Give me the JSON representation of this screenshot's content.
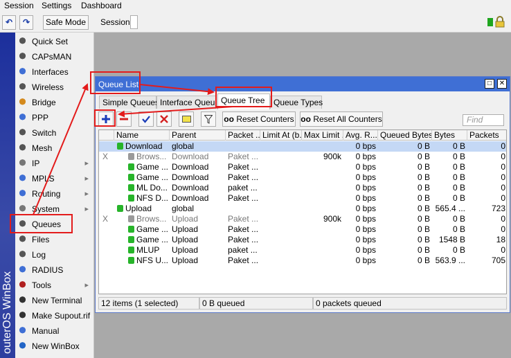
{
  "menubar": [
    "Session",
    "Settings",
    "Dashboard"
  ],
  "toolbar": {
    "undo": "↶",
    "redo": "↷",
    "safe_mode": "Safe Mode",
    "session_label": "Session:"
  },
  "brand": "outerOS WinBox",
  "sidebar": [
    {
      "label": "Quick Set",
      "icon": "quick-set-icon",
      "arrow": ""
    },
    {
      "label": "CAPsMAN",
      "icon": "capsman-icon",
      "arrow": ""
    },
    {
      "label": "Interfaces",
      "icon": "interfaces-icon",
      "arrow": ""
    },
    {
      "label": "Wireless",
      "icon": "wireless-icon",
      "arrow": ""
    },
    {
      "label": "Bridge",
      "icon": "bridge-icon",
      "arrow": ""
    },
    {
      "label": "PPP",
      "icon": "ppp-icon",
      "arrow": ""
    },
    {
      "label": "Switch",
      "icon": "switch-icon",
      "arrow": ""
    },
    {
      "label": "Mesh",
      "icon": "mesh-icon",
      "arrow": ""
    },
    {
      "label": "IP",
      "icon": "ip-icon",
      "arrow": "▸"
    },
    {
      "label": "MPLS",
      "icon": "mpls-icon",
      "arrow": "▸"
    },
    {
      "label": "Routing",
      "icon": "routing-icon",
      "arrow": "▸"
    },
    {
      "label": "System",
      "icon": "system-gear-icon",
      "arrow": "▸"
    },
    {
      "label": "Queues",
      "icon": "queues-icon",
      "arrow": ""
    },
    {
      "label": "Files",
      "icon": "files-icon",
      "arrow": ""
    },
    {
      "label": "Log",
      "icon": "log-icon",
      "arrow": ""
    },
    {
      "label": "RADIUS",
      "icon": "radius-icon",
      "arrow": ""
    },
    {
      "label": "Tools",
      "icon": "tools-icon",
      "arrow": "▸"
    },
    {
      "label": "New Terminal",
      "icon": "terminal-icon",
      "arrow": ""
    },
    {
      "label": "Make Supout.rif",
      "icon": "supout-icon",
      "arrow": ""
    },
    {
      "label": "Manual",
      "icon": "manual-icon",
      "arrow": ""
    },
    {
      "label": "New WinBox",
      "icon": "winbox-icon",
      "arrow": ""
    }
  ],
  "window": {
    "title": "Queue List",
    "restore_glyph": "□",
    "close_glyph": "✕",
    "tabs": [
      "Simple Queues",
      "Interface Queues",
      "Queue Tree",
      "Queue Types"
    ],
    "active_tab": "Queue Tree",
    "buttons": {
      "reset_counters": "Reset Counters",
      "reset_all_counters": "Reset All Counters",
      "oo": "oo"
    },
    "find_placeholder": "Find"
  },
  "table": {
    "columns": [
      "",
      "Name",
      "Parent",
      "Packet ...",
      "Limit At (b...",
      "Max Limit ...",
      "Avg. R...",
      "Queued Bytes",
      "Bytes",
      "Packets"
    ],
    "rows": [
      {
        "flag": "",
        "name": "Download",
        "parent": "global",
        "packet": "",
        "limit_at": "",
        "max_limit": "",
        "avg": "0 bps",
        "queued": "0 B",
        "bytes": "0 B",
        "packets": "0",
        "indent": 0,
        "disabled": false,
        "selected": true
      },
      {
        "flag": "X",
        "name": "Brows...",
        "parent": "Download",
        "packet": "Paket ...",
        "limit_at": "",
        "max_limit": "900k",
        "avg": "0 bps",
        "queued": "0 B",
        "bytes": "0 B",
        "packets": "0",
        "indent": 1,
        "disabled": true,
        "selected": false
      },
      {
        "flag": "",
        "name": "Game ...",
        "parent": "Download",
        "packet": "Paket ...",
        "limit_at": "",
        "max_limit": "",
        "avg": "0 bps",
        "queued": "0 B",
        "bytes": "0 B",
        "packets": "0",
        "indent": 1,
        "disabled": false,
        "selected": false
      },
      {
        "flag": "",
        "name": "Game ...",
        "parent": "Download",
        "packet": "Paket ...",
        "limit_at": "",
        "max_limit": "",
        "avg": "0 bps",
        "queued": "0 B",
        "bytes": "0 B",
        "packets": "0",
        "indent": 1,
        "disabled": false,
        "selected": false
      },
      {
        "flag": "",
        "name": "ML Do...",
        "parent": "Download",
        "packet": "paket ...",
        "limit_at": "",
        "max_limit": "",
        "avg": "0 bps",
        "queued": "0 B",
        "bytes": "0 B",
        "packets": "0",
        "indent": 1,
        "disabled": false,
        "selected": false
      },
      {
        "flag": "",
        "name": "NFS D...",
        "parent": "Download",
        "packet": "Paket ...",
        "limit_at": "",
        "max_limit": "",
        "avg": "0 bps",
        "queued": "0 B",
        "bytes": "0 B",
        "packets": "0",
        "indent": 1,
        "disabled": false,
        "selected": false
      },
      {
        "flag": "",
        "name": "Upload",
        "parent": "global",
        "packet": "",
        "limit_at": "",
        "max_limit": "",
        "avg": "0 bps",
        "queued": "0 B",
        "bytes": "565.4 ...",
        "packets": "723",
        "indent": 0,
        "disabled": false,
        "selected": false
      },
      {
        "flag": "X",
        "name": "Brows...",
        "parent": "Upload",
        "packet": "Paket ...",
        "limit_at": "",
        "max_limit": "900k",
        "avg": "0 bps",
        "queued": "0 B",
        "bytes": "0 B",
        "packets": "0",
        "indent": 1,
        "disabled": true,
        "selected": false
      },
      {
        "flag": "",
        "name": "Game ...",
        "parent": "Upload",
        "packet": "Paket ...",
        "limit_at": "",
        "max_limit": "",
        "avg": "0 bps",
        "queued": "0 B",
        "bytes": "0 B",
        "packets": "0",
        "indent": 1,
        "disabled": false,
        "selected": false
      },
      {
        "flag": "",
        "name": "Game ...",
        "parent": "Upload",
        "packet": "Paket ...",
        "limit_at": "",
        "max_limit": "",
        "avg": "0 bps",
        "queued": "0 B",
        "bytes": "1548 B",
        "packets": "18",
        "indent": 1,
        "disabled": false,
        "selected": false
      },
      {
        "flag": "",
        "name": "MLUP",
        "parent": "Upload",
        "packet": "paket ...",
        "limit_at": "",
        "max_limit": "",
        "avg": "0 bps",
        "queued": "0 B",
        "bytes": "0 B",
        "packets": "0",
        "indent": 1,
        "disabled": false,
        "selected": false
      },
      {
        "flag": "",
        "name": "NFS U...",
        "parent": "Upload",
        "packet": "Paket ...",
        "limit_at": "",
        "max_limit": "",
        "avg": "0 bps",
        "queued": "0 B",
        "bytes": "563.9 ...",
        "packets": "705",
        "indent": 1,
        "disabled": false,
        "selected": false
      }
    ]
  },
  "status": {
    "items": "12 items (1 selected)",
    "queued": "0 B queued",
    "packets": "0 packets queued"
  },
  "colors": {
    "title_bar": "#3f6fd5",
    "annotation_red": "#e31b1b",
    "queue_green": "#27b42a",
    "queue_grey": "#9a9a9a"
  }
}
